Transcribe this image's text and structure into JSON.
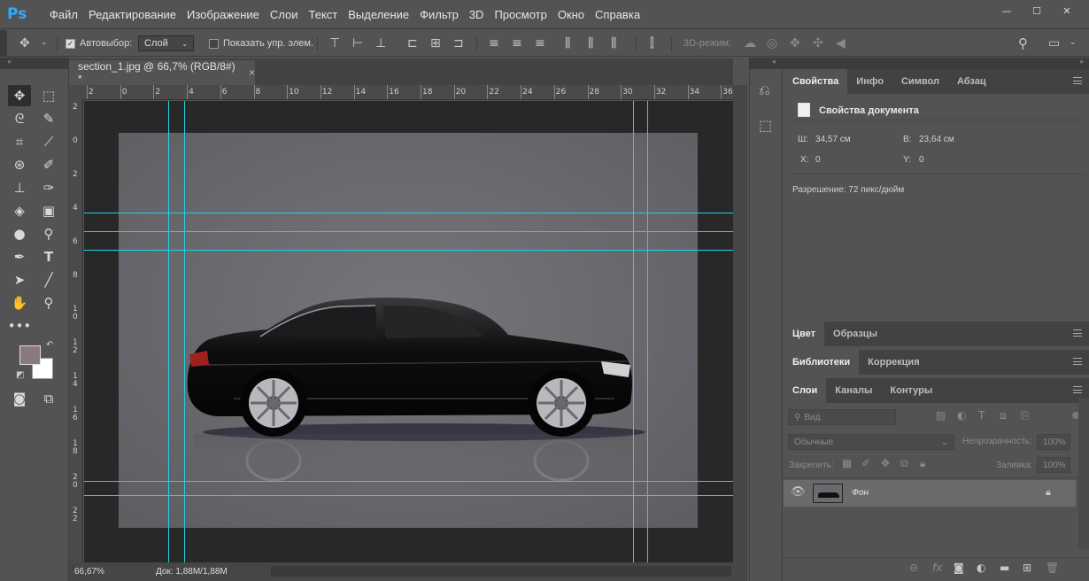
{
  "app": {
    "logo": "Ps"
  },
  "menu": [
    {
      "label": "Файл"
    },
    {
      "label": "Редактирование"
    },
    {
      "label": "Изображение"
    },
    {
      "label": "Слои"
    },
    {
      "label": "Текст"
    },
    {
      "label": "Выделение"
    },
    {
      "label": "Фильтр"
    },
    {
      "label": "3D"
    },
    {
      "label": "Просмотр"
    },
    {
      "label": "Окно"
    },
    {
      "label": "Справка"
    }
  ],
  "window_controls": {
    "minimize": "—",
    "maximize": "☐",
    "close": "✕"
  },
  "options": {
    "autoselect_label": "Автовыбор:",
    "autoselect_value": "Слой",
    "show_transform_label": "Показать упр. элем.",
    "mode_3d_label": "3D-режим:"
  },
  "document": {
    "tab_title": "section_1.jpg @ 66,7% (RGB/8#) *",
    "tab_close": "×",
    "zoom": "66,67%",
    "doc_size": "Док: 1,88M/1,88M",
    "ruler_top": [
      "2",
      "0",
      "2",
      "4",
      "6",
      "8",
      "10",
      "12",
      "14",
      "16",
      "18",
      "20",
      "22",
      "24",
      "26",
      "28",
      "30",
      "32",
      "34",
      "36"
    ],
    "ruler_left": [
      "2",
      "0",
      "2",
      "4",
      "6",
      "8",
      "1\n0",
      "1\n2",
      "1\n4",
      "1\n6",
      "1\n8",
      "2\n0",
      "2\n2"
    ]
  },
  "properties": {
    "tabs": [
      "Свойства",
      "Инфо",
      "Символ",
      "Абзац"
    ],
    "header": "Свойства документа",
    "w_label": "Ш:",
    "w_value": "34,57 см",
    "h_label": "В:",
    "h_value": "23,64 см",
    "x_label": "X:",
    "x_value": "0",
    "y_label": "Y:",
    "y_value": "0",
    "resolution": "Разрешение: 72 пикс/дюйм"
  },
  "color_panel": {
    "tabs": [
      "Цвет",
      "Образцы"
    ]
  },
  "libraries_panel": {
    "tabs": [
      "Библиотеки",
      "Коррекция"
    ]
  },
  "layers_panel": {
    "tabs": [
      "Слои",
      "Каналы",
      "Контуры"
    ],
    "filter_placeholder": "Вид",
    "blend_mode": "Обычные",
    "opacity_label": "Непрозрачность:",
    "opacity_value": "100%",
    "lock_label": "Закрепить:",
    "fill_label": "Заливка:",
    "fill_value": "100%",
    "layers": [
      {
        "name": "Фон",
        "visible": true,
        "locked": true
      }
    ]
  },
  "colors": {
    "accent_blue": "#31a8ff",
    "guide": "#1fd3e6",
    "foreground": "#8a7a7c",
    "background": "#ffffff"
  }
}
